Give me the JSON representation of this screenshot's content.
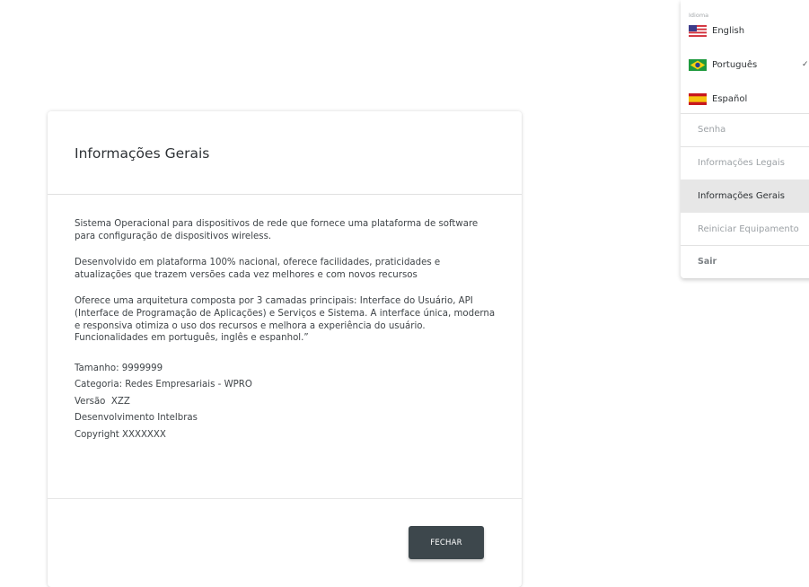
{
  "dialog": {
    "title": "Informações Gerais",
    "paragraphs": [
      "Sistema Operacional para dispositivos de rede que fornece uma plataforma de software para configuração de dispositivos wireless.",
      "Desenvolvido em plataforma 100% nacional, oferece facilidades, praticidades e atualizações que trazem versões cada vez melhores e com novos recursos",
      "Oferece uma arquitetura composta por 3 camadas principais: Interface do Usuário, API (Interface de Programação de Aplicações) e Serviços e Sistema. A interface única, moderna e responsiva otimiza o uso dos recursos e melhora a experiência do usuário. Funcionalidades em português, inglês e espanhol.”"
    ],
    "meta": [
      "Tamanho: 9999999",
      "Categoria: Redes Empresariais - WPRO",
      "Versão  XZZ",
      "Desenvolvimento Intelbras",
      "Copyright XXXXXXX"
    ],
    "close_label": "FECHAR"
  },
  "menu": {
    "language_section_label": "Idioma",
    "languages": [
      {
        "label": "English",
        "flag": "us-flag-icon",
        "selected": false
      },
      {
        "label": "Português",
        "flag": "brazil-flag-icon",
        "selected": true
      },
      {
        "label": "Español",
        "flag": "spain-flag-icon",
        "selected": false
      }
    ],
    "check_glyph": "✓",
    "items": [
      {
        "label": "Senha",
        "active": false
      },
      {
        "label": "Informações Legais",
        "active": false
      },
      {
        "label": "Informações Gerais",
        "active": true
      },
      {
        "label": "Reiniciar Equipamento",
        "active": false
      },
      {
        "label": "Sair",
        "active": false
      }
    ]
  },
  "colors": {
    "button_bg": "#3d474c",
    "active_item_bg": "#e7e7e7",
    "muted_text": "#9da2a6"
  }
}
